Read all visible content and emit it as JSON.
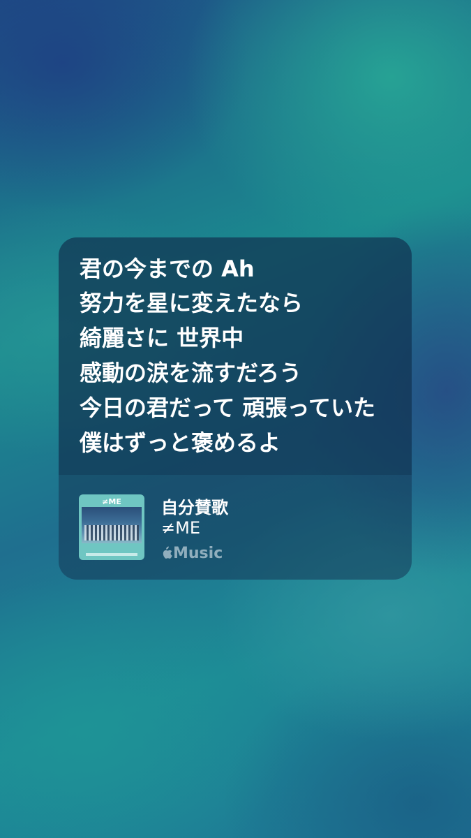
{
  "lyrics": [
    "君の今までの Ah",
    "努力を星に変えたなら",
    "綺麗さに 世界中",
    "感動の涙を流すだろう",
    "今日の君だって 頑張っていた",
    "僕はずっと褒めるよ"
  ],
  "track": {
    "title": "自分賛歌",
    "artist": "≠ME",
    "service_label": "Music",
    "service_icon": "apple-icon",
    "artwork_logo": "≠ME"
  },
  "colors": {
    "text_primary": "#ffffff",
    "text_secondary": "#9fb7c0",
    "card": "#1f4a66"
  }
}
